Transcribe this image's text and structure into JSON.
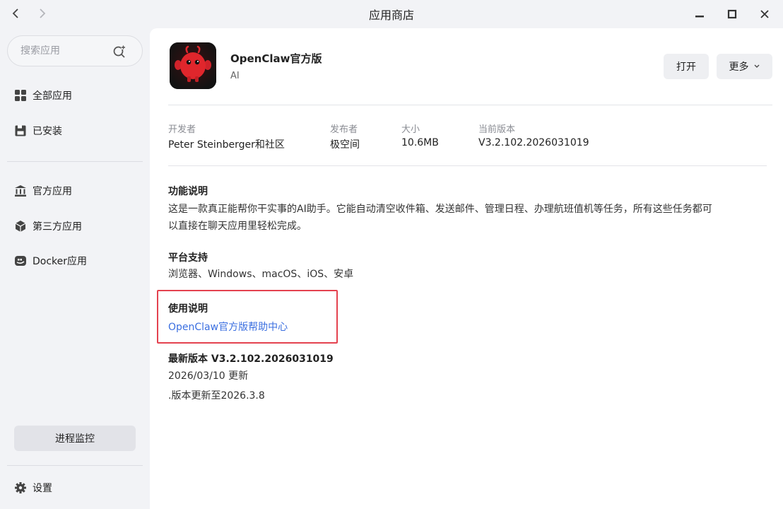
{
  "window": {
    "title": "应用商店"
  },
  "sidebar": {
    "search_placeholder": "搜索应用",
    "items": [
      {
        "label": "全部应用",
        "icon": "grid-icon"
      },
      {
        "label": "已安装",
        "icon": "save-icon"
      },
      {
        "label": "官方应用",
        "icon": "bank-icon"
      },
      {
        "label": "第三方应用",
        "icon": "cube-icon"
      },
      {
        "label": "Docker应用",
        "icon": "docker-icon"
      }
    ],
    "monitor_label": "进程监控",
    "settings_label": "设置"
  },
  "app": {
    "name": "OpenClaw官方版",
    "category": "AI",
    "open_label": "打开",
    "more_label": "更多"
  },
  "meta": {
    "developer_label": "开发者",
    "developer": "Peter Steinberger和社区",
    "publisher_label": "发布者",
    "publisher": "极空间",
    "size_label": "大小",
    "size": "10.6MB",
    "version_label": "当前版本",
    "version": "V3.2.102.2026031019"
  },
  "sections": {
    "feature_title": "功能说明",
    "feature_line1": "这是一款真正能帮你干实事的AI助手。它能自动清空收件箱、发送邮件、管理日程、办理航班值机等任务，所有这些任务都可",
    "feature_line2": "以直接在聊天应用里轻松完成。",
    "platform_title": "平台支持",
    "platform_text": "浏览器、Windows、macOS、iOS、安卓",
    "usage_title": "使用说明",
    "usage_link": "OpenClaw官方版帮助中心",
    "latest_title": "最新版本 V3.2.102.2026031019",
    "latest_date": "2026/03/10 更新",
    "latest_note": ".版本更新至2026.3.8"
  },
  "colors": {
    "accent_link": "#3b6fe0",
    "highlight": "#e4424f",
    "mascot": "#e0262c"
  }
}
